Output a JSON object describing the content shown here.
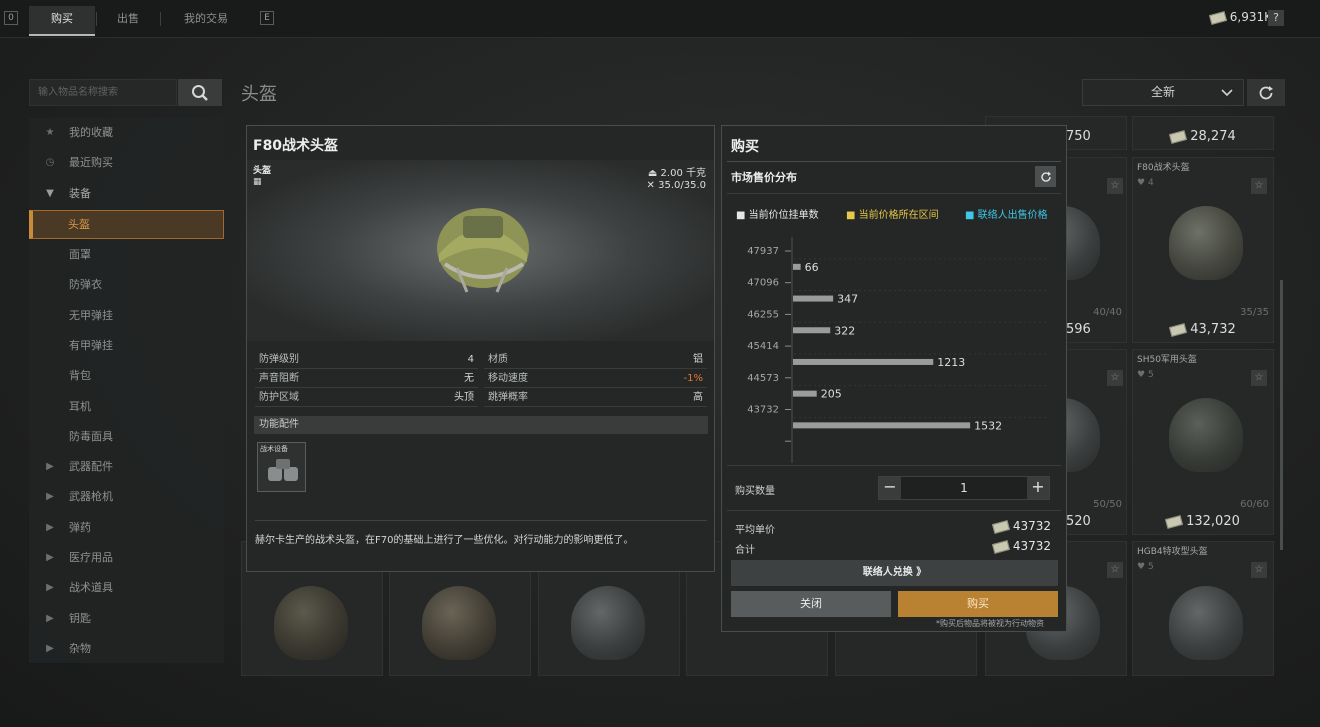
{
  "topbar": {
    "left_key": "0",
    "tabs": [
      {
        "label": "购买"
      },
      {
        "label": "出售"
      },
      {
        "label": "我的交易"
      }
    ],
    "right_key": "E",
    "balance": "6,931K",
    "help": "?"
  },
  "search": {
    "placeholder": "输入物品名称搜索"
  },
  "sidebar": {
    "items": [
      {
        "label": "我的收藏",
        "icon": "star-icon"
      },
      {
        "label": "最近购买",
        "icon": "clock-icon"
      },
      {
        "label": "装备",
        "icon": "triangle-down-icon"
      },
      {
        "label": "头盔"
      },
      {
        "label": "面罩"
      },
      {
        "label": "防弹衣"
      },
      {
        "label": "无甲弹挂"
      },
      {
        "label": "有甲弹挂"
      },
      {
        "label": "背包"
      },
      {
        "label": "耳机"
      },
      {
        "label": "防毒面具"
      },
      {
        "label": "武器配件",
        "icon": "triangle-right-icon"
      },
      {
        "label": "武器枪机",
        "icon": "triangle-right-icon"
      },
      {
        "label": "弹药",
        "icon": "triangle-right-icon"
      },
      {
        "label": "医疗用品",
        "icon": "triangle-right-icon"
      },
      {
        "label": "战术道具",
        "icon": "triangle-right-icon"
      },
      {
        "label": "钥匙",
        "icon": "triangle-right-icon"
      },
      {
        "label": "杂物",
        "icon": "triangle-right-icon"
      }
    ]
  },
  "main": {
    "category_title": "头盔",
    "sort": "全新"
  },
  "grid": {
    "cards": [
      {
        "name": "",
        "price": "28,274",
        "likes": "",
        "durability": ""
      },
      {
        "name": "F80战术头盔",
        "price": "43,732",
        "likes": "4",
        "durability": "35/35"
      },
      {
        "name": "SH50军用头盔",
        "price": "132,020",
        "likes": "5",
        "durability": "60/60"
      },
      {
        "name": "HGB4特攻型头盔",
        "price": "",
        "likes": "5",
        "durability": ""
      }
    ],
    "partial": {
      "price_top": "750",
      "dur_a": "40/40",
      "price_a": "596",
      "dur_b": "50/50",
      "price_b": "520"
    }
  },
  "detail": {
    "title": "F80战术头盔",
    "type_label": "头盔",
    "weight": "2.00 千克",
    "durability": "35.0/35.0",
    "stats": [
      {
        "k": "防弹级别",
        "v": "4",
        "k2": "材质",
        "v2": "铝"
      },
      {
        "k": "声音阻断",
        "v": "无",
        "k2": "移动速度",
        "v2": "-1%"
      },
      {
        "k": "防护区域",
        "v": "头顶",
        "k2": "跳弹概率",
        "v2": "高"
      }
    ],
    "accessories_label": "功能配件",
    "accessory_slot_label": "战术设备",
    "description": "赫尔卡生产的战术头盔，在F70的基础上进行了一些优化。对行动能力的影响更低了。",
    "colors": {
      "negative": "#e07838"
    }
  },
  "buy": {
    "title": "购买",
    "distribution_title": "市场售价分布",
    "legend": [
      {
        "label": "当前价位挂单数",
        "color": "#e6e6e6"
      },
      {
        "label": "当前价格所在区间",
        "color": "#e6c84a"
      },
      {
        "label": "联络人出售价格",
        "color": "#3cc8e6"
      }
    ],
    "quantity_label": "购买数量",
    "quantity": "1",
    "avg_label": "平均单价",
    "avg_price": "43732",
    "total_label": "合计",
    "total_price": "43732",
    "exchange_label": "联络人兑换 》",
    "close_label": "关闭",
    "buy_label": "购买",
    "note": "*购买后物品将被视为行动物资",
    "colors": {
      "buy_button": "#b98233",
      "close_button": "#595c5c"
    }
  },
  "chart_data": {
    "type": "bar",
    "orientation": "horizontal",
    "title": "市场售价分布",
    "y_ticks": [
      "47937",
      "47096",
      "46255",
      "45414",
      "44573",
      "43732"
    ],
    "values": [
      66,
      347,
      322,
      1213,
      205,
      1532
    ],
    "xlim": [
      0,
      1600
    ]
  }
}
